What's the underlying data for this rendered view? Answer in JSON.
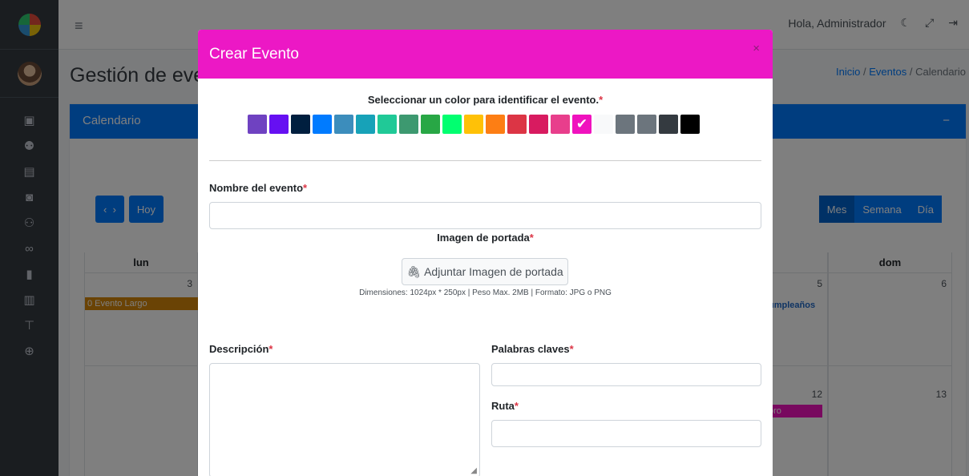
{
  "topbar": {
    "greeting": "Hola, Administrador",
    "menu_icon": "bars-icon"
  },
  "page": {
    "title": "Gestión de eventos",
    "breadcrumb": [
      "Inicio",
      "Eventos",
      "Calendario"
    ],
    "sep": "/"
  },
  "card": {
    "title": "Calendario",
    "collapse": "−"
  },
  "calendar": {
    "today_label": "Hoy",
    "views": [
      "Mes",
      "Semana",
      "Día"
    ],
    "days_visible": [
      {
        "name": "lun"
      },
      {
        "name": "dom"
      }
    ],
    "numbers": [
      "3",
      "5",
      "6",
      "12",
      "13"
    ],
    "events": [
      "0 Evento Largo",
      "umpleaños",
      "oro"
    ]
  },
  "modal": {
    "title": "Crear Evento",
    "close": "×",
    "color_label": "Seleccionar un color para identificar el evento.",
    "colors": [
      "#6f42c1",
      "#6610f2",
      "#001f3f",
      "#007bff",
      "#3c8dbc",
      "#17a2b8",
      "#20c997",
      "#3d9970",
      "#28a745",
      "#01ff70",
      "#ffc107",
      "#fd7e14",
      "#dc3545",
      "#d81b60",
      "#e83e8c",
      "#f012be",
      "#f8f9fa",
      "#6c757d",
      "#6c757d",
      "#343a40",
      "#000000"
    ],
    "selected_color": "#f012be",
    "name_label": "Nombre del evento",
    "name_value": "",
    "cover_label": "Imagen de portada",
    "attach_label": "Adjuntar Imagen de portada",
    "dims": "Dimensiones: 1024px * 250px | Peso Max. 2MB | Formato: JPG o PNG",
    "desc_label": "Descripción",
    "keywords_label": "Palabras claves",
    "route_label": "Ruta",
    "required_mark": "*"
  }
}
